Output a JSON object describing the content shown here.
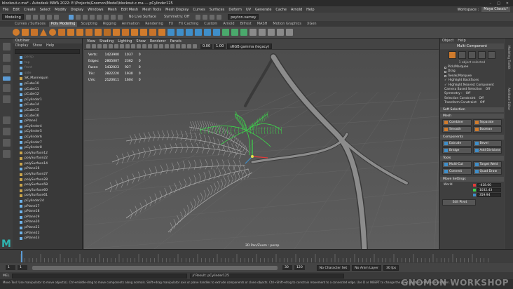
{
  "window": {
    "title": "blockout-c.ma* - Autodesk MAYA 2022: E:\\Projects\\Gnomon\\Model\\blockout-c.ma   ---   pCylinder125"
  },
  "menubar": {
    "items": [
      "File",
      "Edit",
      "Create",
      "Select",
      "Modify",
      "Display",
      "Windows",
      "Mesh",
      "Edit Mesh",
      "Mesh Tools",
      "Mesh Display",
      "Curves",
      "Surfaces",
      "Deform",
      "UV",
      "Generate",
      "Cache",
      "Arnold",
      "Help"
    ],
    "workspace_label": "Workspace :",
    "workspace": "Maya Classic*"
  },
  "statusline": {
    "mode": "Modeling",
    "symmetry": "Symmetry: Off",
    "live_surface": "No Live Surface",
    "user": "peyton.varney"
  },
  "shelf": {
    "tabs": [
      "Curves / Surfaces",
      "Poly Modeling",
      "Sculpting",
      "Rigging",
      "Animation",
      "Rendering",
      "FX",
      "FX Caching",
      "Custom",
      "Arnold",
      "Bifrost",
      "MASH",
      "Motion Graphics",
      "XGen"
    ],
    "active_tab": "Poly Modeling"
  },
  "outliner": {
    "title": "Outliner",
    "menu": [
      "Display",
      "Show",
      "Help"
    ],
    "items": [
      {
        "name": "persp",
        "dim": true
      },
      {
        "name": "top",
        "dim": true
      },
      {
        "name": "front",
        "dim": true
      },
      {
        "name": "side",
        "dim": true
      },
      {
        "name": "SK_Mannequin",
        "dim": false,
        "group": true
      },
      {
        "name": "pCube10",
        "dim": false
      },
      {
        "name": "pCube11",
        "dim": false
      },
      {
        "name": "pCube12",
        "dim": false
      },
      {
        "name": "pCylinder1",
        "dim": false
      },
      {
        "name": "pCube14",
        "dim": false
      },
      {
        "name": "pCube15",
        "dim": false
      },
      {
        "name": "pCube16",
        "dim": false
      },
      {
        "name": "pPlane1",
        "dim": false
      },
      {
        "name": "pCylinder4",
        "dim": false
      },
      {
        "name": "pCylinder5",
        "dim": false
      },
      {
        "name": "pCylinder6",
        "dim": false
      },
      {
        "name": "pCylinder7",
        "dim": false
      },
      {
        "name": "pCylinder8",
        "dim": false
      },
      {
        "name": "polySurface12",
        "dim": false,
        "group": true
      },
      {
        "name": "polySurface22",
        "dim": false,
        "group": true
      },
      {
        "name": "polySurface14",
        "dim": false,
        "group": true
      },
      {
        "name": "pPlane16",
        "dim": false
      },
      {
        "name": "polySurface27",
        "dim": false,
        "group": true
      },
      {
        "name": "polySurface28",
        "dim": false,
        "group": true
      },
      {
        "name": "polySurface58",
        "dim": false,
        "group": true
      },
      {
        "name": "polySurface60",
        "dim": false,
        "group": true
      },
      {
        "name": "polySurface61",
        "dim": false,
        "group": true
      },
      {
        "name": "pCylinder24",
        "dim": false
      },
      {
        "name": "pPlane17",
        "dim": false
      },
      {
        "name": "pPlane18",
        "dim": false
      },
      {
        "name": "pPlane19",
        "dim": false
      },
      {
        "name": "pPlane20",
        "dim": false
      },
      {
        "name": "pPlane21",
        "dim": false
      },
      {
        "name": "pPlane22",
        "dim": false
      },
      {
        "name": "pPlane23",
        "dim": false
      }
    ]
  },
  "viewport": {
    "menu": [
      "View",
      "Shading",
      "Lighting",
      "Show",
      "Renderer",
      "Panels"
    ],
    "gamma_value": "0.00",
    "gamma_scale": "1.00",
    "color_space": "sRGB gamma (legacy)",
    "hud": [
      {
        "label": "Verts:",
        "a": "1423900",
        "b": "1037",
        "c": "0"
      },
      {
        "label": "Edges:",
        "a": "2805007",
        "b": "2362",
        "c": "0"
      },
      {
        "label": "Faces:",
        "a": "1432023",
        "b": "927",
        "c": "0"
      },
      {
        "label": "Tris:",
        "a": "2822220",
        "b": "1930",
        "c": "0"
      },
      {
        "label": "UVs:",
        "a": "2120611",
        "b": "1604",
        "c": "0"
      }
    ],
    "camera_label": "2D Pan/Zoom : persp"
  },
  "attr": {
    "menu": [
      "Object",
      "Help"
    ],
    "title": "Multi-Component",
    "selected": "1 object selected",
    "options": [
      {
        "label": "Pick/Marquee",
        "checked": false
      },
      {
        "label": "Drag",
        "checked": false
      },
      {
        "label": "Tweak/Marquee",
        "checked": false
      },
      {
        "label": "Highlight Backfaces",
        "checked": true
      },
      {
        "label": "Highlight Nearest Component",
        "checked": true
      }
    ],
    "camera_based": "Camera Based Selection",
    "camera_based_val": "Off",
    "symmetry": "Symmetry :",
    "symmetry_val": "Off",
    "selection_constraint": "Selection Constraint",
    "selection_constraint_val": "Off",
    "transform_constraint": "Transform Constraint",
    "transform_constraint_val": "Off",
    "soft_selection": "Soft Selection",
    "mesh_section": "Mesh",
    "mesh_buttons": [
      "Combine",
      "Separate",
      "Smooth",
      "Boolean"
    ],
    "components_section": "Components",
    "component_buttons": [
      "Extrude",
      "Bevel",
      "Bridge",
      "Add Divisions"
    ],
    "tools_section": "Tools",
    "tool_buttons": [
      "Multi-Cut",
      "Target Weld",
      "Connect",
      "Quad Draw"
    ],
    "move_section": "Move Settings",
    "world_label": "World",
    "x": "-418.00",
    "y": "1032.43",
    "z": "359.94",
    "edit_pivot": "Edit Pivot",
    "side_tabs": [
      "Modeling Toolkit",
      "Attribute Editor"
    ]
  },
  "timeline": {
    "start": "1",
    "end": "120",
    "range_start": "1",
    "range_end": "30",
    "range_end2": "120",
    "current": "1",
    "no_character_set": "No Character Set",
    "no_anim_layer": "No Anim Layer",
    "fps": "30 fps"
  },
  "cmdline": {
    "lang": "MEL",
    "result": "// Result: pCylinder125"
  },
  "helpline": {
    "text": "Move Tool: Use manipulator to move object(s). Ctrl+middle-drag to move components along normals. Shift+drag manipulator axis or plane handles to extrude components or clone objects. Ctrl+Shift+drag to constrain movement to a connected edge. Use D or INSERT to change the pivot position and axis orientation."
  },
  "logo": {
    "letter": "M"
  },
  "watermark": {
    "text": "GNOMON WORKSHOP"
  },
  "colors": {
    "accent": "#d07b2c",
    "selected_tool": "#5b9bd5",
    "selection_green": "#3bd74a",
    "logo": "#2fb5b1"
  }
}
